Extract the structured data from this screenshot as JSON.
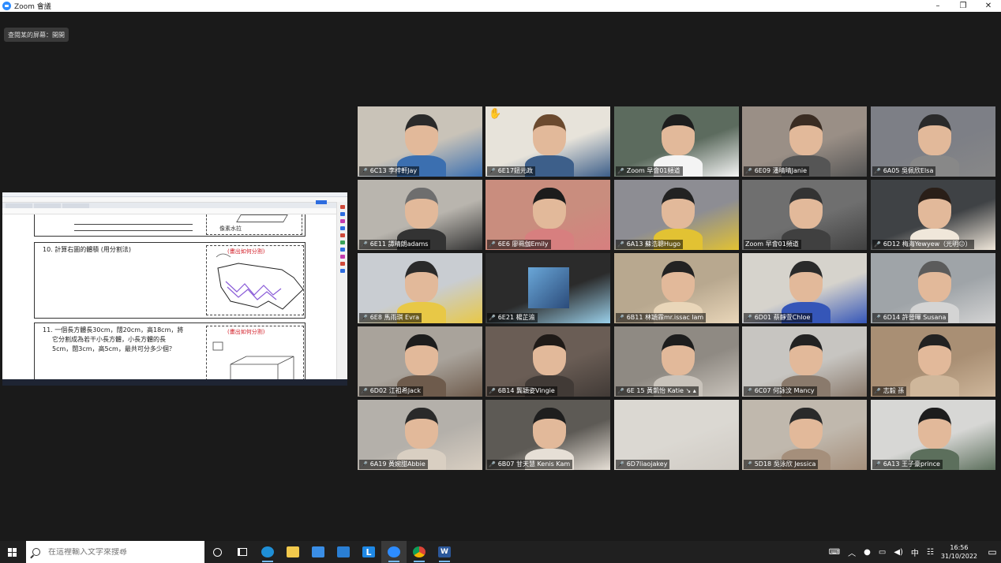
{
  "window": {
    "title": "Zoom 會議",
    "minimize": "–",
    "maximize": "❐",
    "close": "✕"
  },
  "viewing_label": "查閱某的屏幕：開開",
  "shared_screen": {
    "q_top_label": "像素水拉",
    "q10_text": "10. 計算右圖的體積 (用分割法)",
    "q10_hint": "(畫出如何分割)",
    "q11_text_line1": "11. 一個長方體長30cm，闊20cm，高18cm，將",
    "q11_text_line2": "它分割成為若干小長方體，小長方體的長",
    "q11_text_line3": "5cm，闊3cm，高5cm，最共可分多少個？",
    "q11_hint": "(畫出如何分割)"
  },
  "participants": [
    {
      "name": "6C13 李梓軒Jay",
      "muted": true
    },
    {
      "name": "6E17鈕元政",
      "muted": true,
      "raised_hand": true
    },
    {
      "name": "Zoom 早會01頻道",
      "muted": true
    },
    {
      "name": "6E09 潘晴晴Janie",
      "muted": true
    },
    {
      "name": "6A05 吳佩欣Elsa",
      "muted": true
    },
    {
      "name": "6E11 譚晴朗adams",
      "muted": true
    },
    {
      "name": "6E6 廖珮伽Emily",
      "muted": true
    },
    {
      "name": "6A13 蘇浩聰Hugo",
      "muted": true
    },
    {
      "name": "Zoom 早會01頻道",
      "muted": false,
      "active_speaker": true
    },
    {
      "name": "6D12 梅海Yewyew（光明😐）",
      "muted": true
    },
    {
      "name": "6E8 馬雨琪 Evra",
      "muted": true
    },
    {
      "name": "6E21 楊芷渝",
      "muted": true
    },
    {
      "name": "6B11 林穎霖mr.issac lam",
      "muted": true
    },
    {
      "name": "6D01 蔡靜萱Chloe",
      "muted": true
    },
    {
      "name": "6D14 許晉暉 Susana",
      "muted": true
    },
    {
      "name": "6D02 江祖希Jack",
      "muted": true
    },
    {
      "name": "6B14 龔穎姿Vingie",
      "muted": true
    },
    {
      "name": "6E 15 黃凱怡 Katie ↘ ▴",
      "muted": true
    },
    {
      "name": "6C07 何詠汶 Mancy",
      "muted": true
    },
    {
      "name": "志毅 孫",
      "muted": true
    },
    {
      "name": "6A19 黃婉甜Abbie",
      "muted": true
    },
    {
      "name": "6B07 甘天慧 Kenis Kam",
      "muted": true
    },
    {
      "name": "6D7liaojakey",
      "muted": true
    },
    {
      "name": "5D18 吳泳欣 Jessica",
      "muted": true
    },
    {
      "name": "6A13 王子豪prince",
      "muted": true
    }
  ],
  "taskbar": {
    "search_placeholder": "在這裡輸入文字來搜尋",
    "ime_label": "中",
    "time": "16:56",
    "date": "31/10/2022"
  }
}
